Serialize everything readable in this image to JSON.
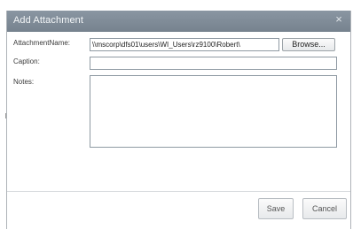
{
  "dialog": {
    "title": "Add Attachment",
    "close_glyph": "×"
  },
  "form": {
    "attachment_name_label": "AttachmentName:",
    "attachment_name_value": "\\\\mscorp\\dfs01\\users\\WI_Users\\rz9100\\Robert\\",
    "browse_label": "Browse...",
    "caption_label": "Caption:",
    "caption_value": "",
    "notes_label": "Notes:",
    "notes_value": ""
  },
  "footer": {
    "save_label": "Save",
    "cancel_label": "Cancel"
  },
  "colors": {
    "titlebar": "#7e8a96",
    "title_text": "#f2f5f7",
    "field_border": "#8f9aa3"
  },
  "icons": {
    "close": "close-icon"
  }
}
